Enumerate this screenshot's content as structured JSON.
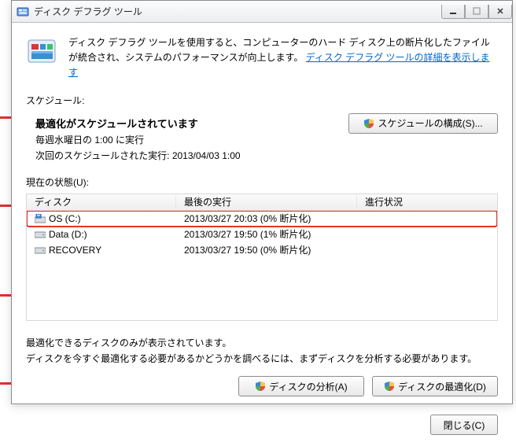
{
  "window": {
    "title": "ディスク デフラグ ツール"
  },
  "intro": {
    "text_prefix": "ディスク デフラグ ツールを使用すると、コンピューターのハード ディスク上の断片化したファイルが統合され、システムのパフォーマンスが向上します。",
    "link": "ディスク デフラグ ツールの詳細を表示します"
  },
  "schedule": {
    "label": "スケジュール:",
    "status": "最適化がスケジュールされています",
    "freq": "毎週水曜日の 1:00 に実行",
    "next": "次回のスケジュールされた実行: 2013/04/03 1:00",
    "configure_btn": "スケジュールの構成(S)..."
  },
  "status_label": "現在の状態(U):",
  "columns": {
    "disk": "ディスク",
    "last_run": "最後の実行",
    "progress": "進行状況"
  },
  "disks": [
    {
      "icon": "os",
      "name": "OS (C:)",
      "last_run": "2013/03/27 20:03 (0% 断片化)",
      "selected": true
    },
    {
      "icon": "hdd",
      "name": "Data (D:)",
      "last_run": "2013/03/27 19:50 (1% 断片化)",
      "selected": false
    },
    {
      "icon": "hdd",
      "name": "RECOVERY",
      "last_run": "2013/03/27 19:50 (0% 断片化)",
      "selected": false
    }
  ],
  "hint": {
    "line1": "最適化できるディスクのみが表示されています。",
    "line2": "ディスクを今すぐ最適化する必要があるかどうかを調べるには、まずディスクを分析する必要があります。"
  },
  "buttons": {
    "analyze": "ディスクの分析(A)",
    "optimize": "ディスクの最適化(D)",
    "close": "閉じる(C)"
  }
}
